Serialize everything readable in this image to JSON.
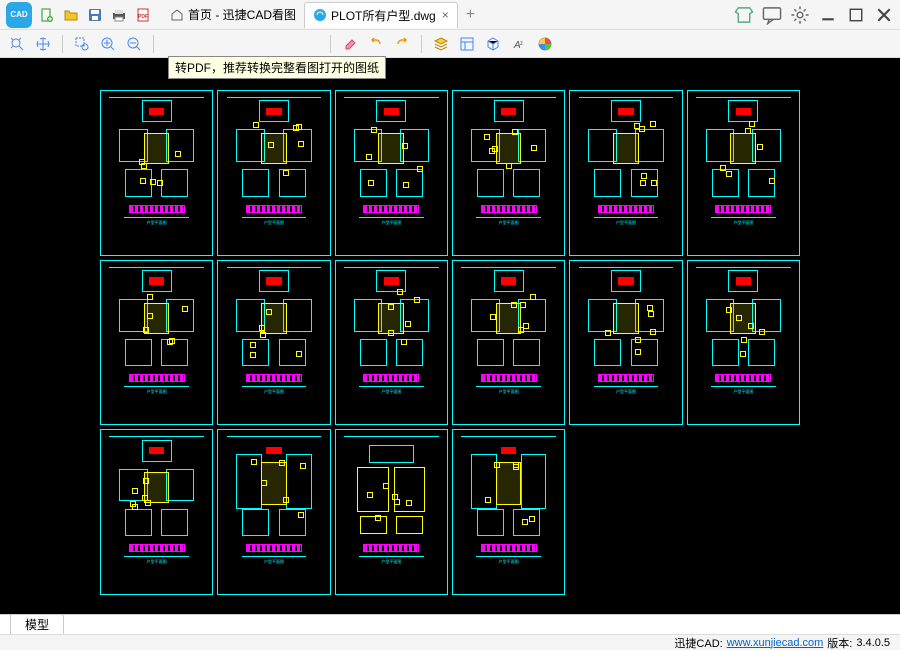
{
  "titlebar": {
    "app_abbrev": "CAD",
    "tab_home": "首页 - 迅捷CAD看图",
    "tab_file": "PLOT所有户型.dwg",
    "tab_close": "×",
    "tab_add": "+"
  },
  "toolbar": {
    "tooltip_pdf": "转PDF，推荐转换完整看图打开的图纸"
  },
  "canvas": {
    "sheet_caption": "户型平面图"
  },
  "bottombar": {
    "model_tab": "模型"
  },
  "statusbar": {
    "brand": "迅捷CAD:",
    "url": "www.xunjiecad.com",
    "version_label": "版本:",
    "version": "3.4.0.5"
  }
}
